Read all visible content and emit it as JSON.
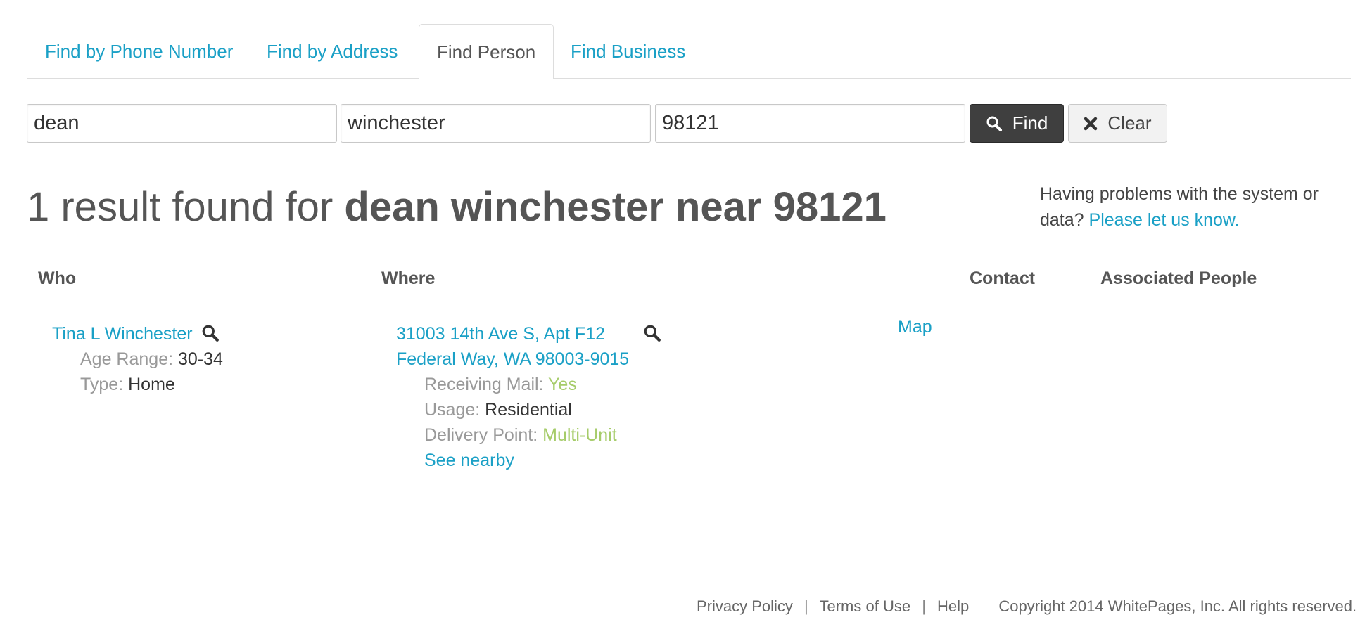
{
  "tabs": [
    {
      "label": "Find by Phone Number"
    },
    {
      "label": "Find by Address"
    },
    {
      "label": "Find Person"
    },
    {
      "label": "Find Business"
    }
  ],
  "search": {
    "first_value": "dean",
    "last_value": "winchester",
    "location_value": "98121",
    "find_label": "Find",
    "clear_label": "Clear"
  },
  "results": {
    "count_text": "1 result found for",
    "query_text": "dean winchester near 98121",
    "help_text": "Having problems with the system or data?",
    "help_link": "Please let us know."
  },
  "table": {
    "headers": {
      "who": "Who",
      "where": "Where",
      "contact": "Contact",
      "associated": "Associated People"
    },
    "rows": [
      {
        "name": "Tina L Winchester",
        "age_label": "Age Range:",
        "age_value": "30-34",
        "type_label": "Type:",
        "type_value": "Home",
        "address_line1": "31003 14th Ave S, Apt F12",
        "address_line2": "Federal Way, WA 98003-9015",
        "mail_label": "Receiving Mail:",
        "mail_value": "Yes",
        "usage_label": "Usage:",
        "usage_value": "Residential",
        "delivery_label": "Delivery Point:",
        "delivery_value": "Multi-Unit",
        "nearby_link": "See nearby",
        "map_link": "Map"
      }
    ]
  },
  "footer": {
    "privacy": "Privacy Policy",
    "sep": "|",
    "terms": "Terms of Use",
    "help": "Help",
    "copyright": "Copyright 2014 WhitePages, Inc. All rights reserved."
  },
  "colors": {
    "link": "#1aa0c6",
    "status_green": "#a6cc6a",
    "label_gray": "#999999",
    "find_button": "#3f3f3f"
  },
  "icons": [
    "search-icon",
    "close-icon"
  ]
}
